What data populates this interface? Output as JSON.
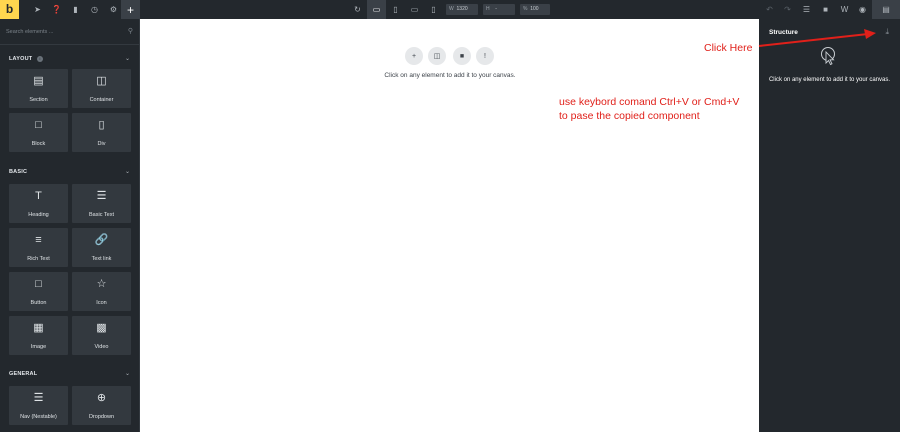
{
  "topbar": {
    "logo": "b",
    "width_label": "W",
    "width_value": "1320",
    "height_label": "H",
    "height_value": "-",
    "zoom_label": "%",
    "zoom_value": "100"
  },
  "sidebar": {
    "search_placeholder": "Search elements ...",
    "sections": [
      {
        "title": "LAYOUT",
        "items": [
          "Section",
          "Container",
          "Block",
          "Div"
        ]
      },
      {
        "title": "BASIC",
        "items": [
          "Heading",
          "Basic Text",
          "Rich Text",
          "Text link",
          "Button",
          "Icon",
          "Image",
          "Video"
        ]
      },
      {
        "title": "GENERAL",
        "items": [
          "Nav (Nestable)",
          "Dropdown"
        ]
      }
    ]
  },
  "canvas": {
    "hint": "Click on any element to add it to your canvas."
  },
  "structure": {
    "title": "Structure",
    "hint": "Click on any element to add it to your canvas."
  },
  "annotations": {
    "click_here": "Click Here",
    "instruction_line1": "use keybord comand Ctrl+V or Cmd+V",
    "instruction_line2": "to pase the copied component",
    "color": "#e0201a"
  },
  "colors": {
    "accent": "#ffd64f",
    "panel_bg": "#23282d",
    "tile_bg": "#33393f"
  }
}
